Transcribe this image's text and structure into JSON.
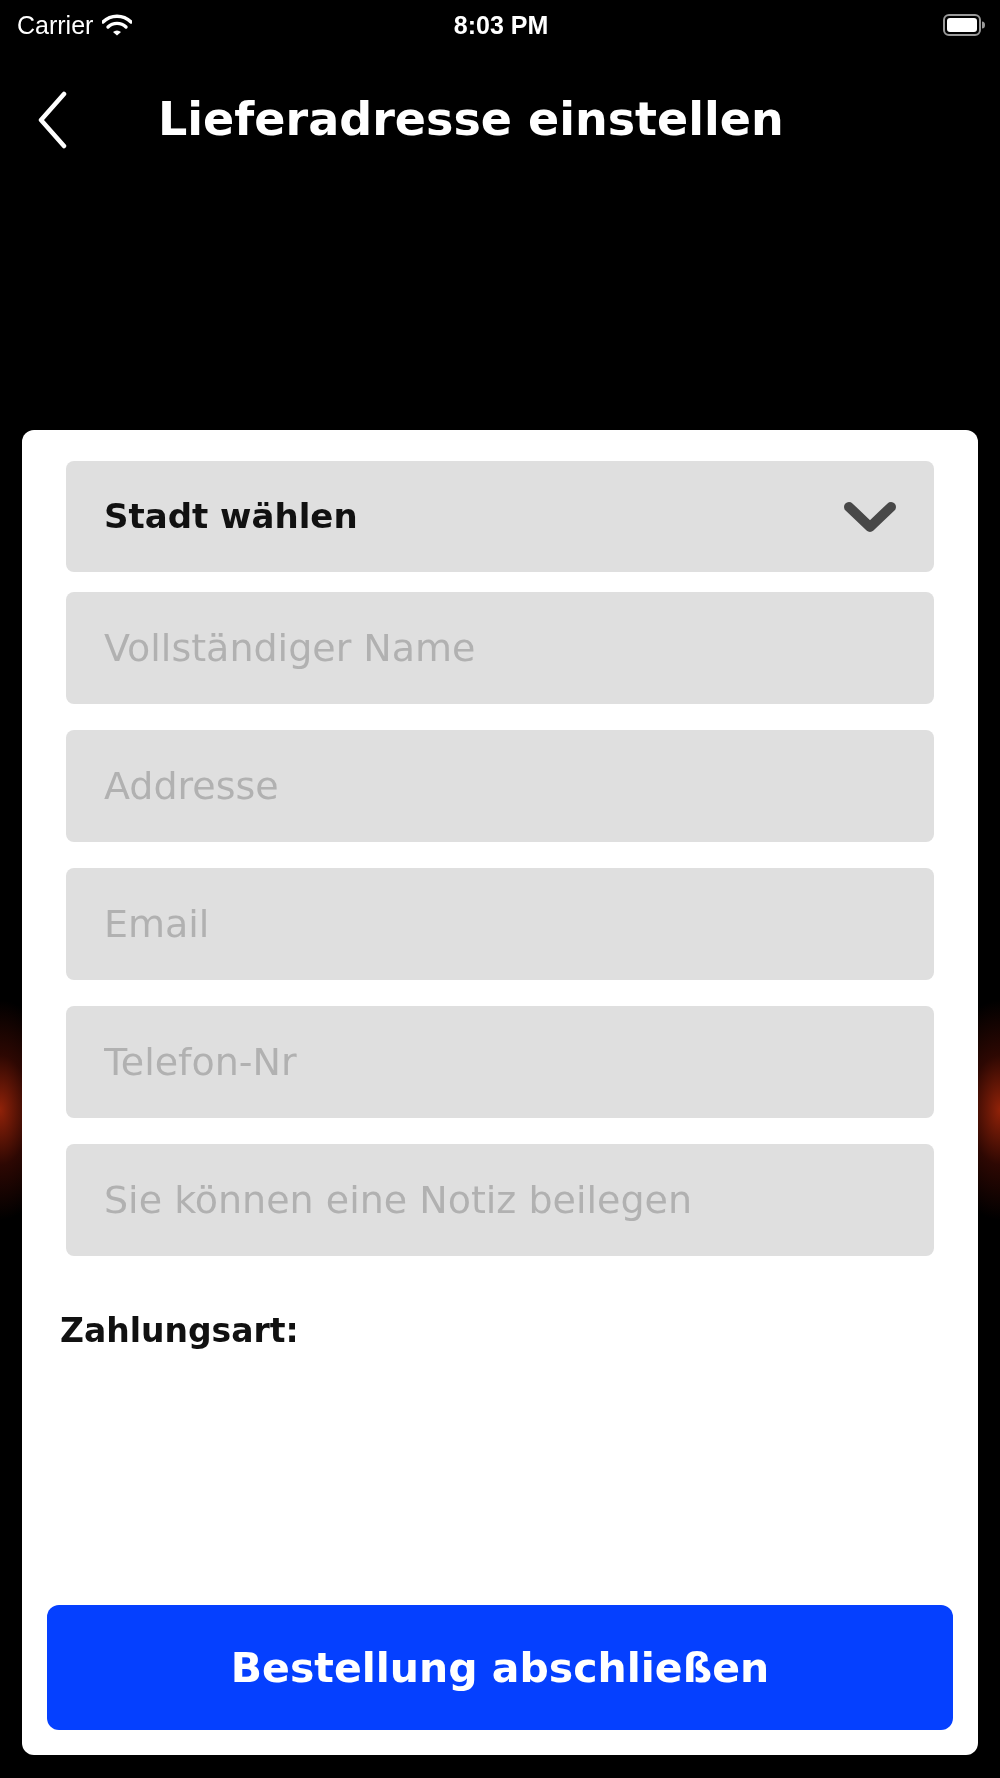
{
  "status_bar": {
    "carrier": "Carrier",
    "time": "8:03 PM"
  },
  "nav_bar": {
    "title": "Lieferadresse einstellen"
  },
  "form": {
    "city_select": {
      "value": "Stadt wählen"
    },
    "fields": [
      {
        "placeholder": "Vollständiger Name"
      },
      {
        "placeholder": "Addresse"
      },
      {
        "placeholder": "Email"
      },
      {
        "placeholder": "Telefon-Nr"
      },
      {
        "placeholder": "Sie können eine Notiz beilegen"
      }
    ],
    "payment_label": "Zahlungsart:",
    "submit_button": "Bestellung abschließen"
  }
}
